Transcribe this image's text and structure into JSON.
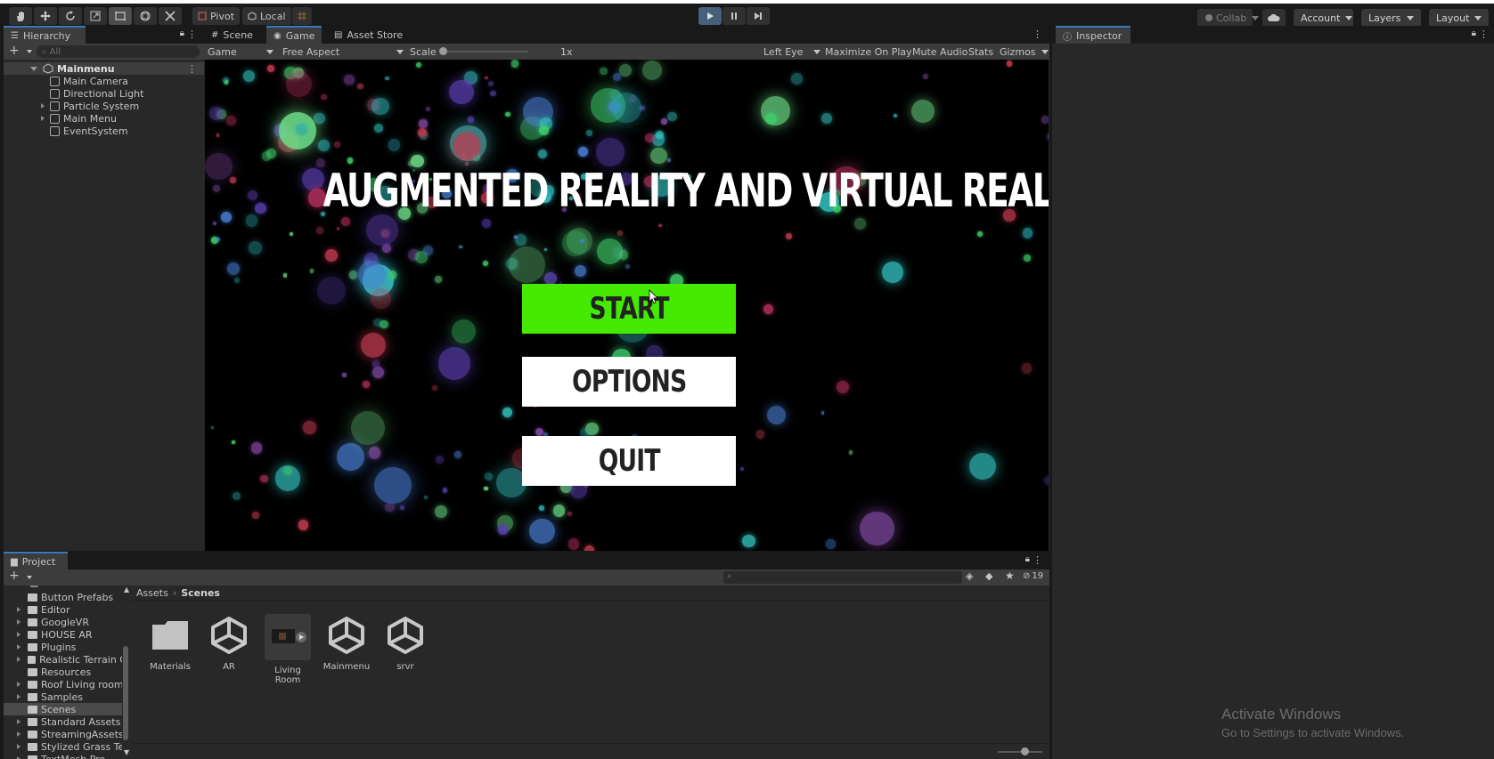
{
  "toolbar": {
    "tools": [
      "hand-tool",
      "move-tool",
      "rotate-tool",
      "scale-tool",
      "rect-tool",
      "transform-tool",
      "custom-tool"
    ],
    "pivot_label": "Pivot",
    "local_label": "Local",
    "collab_label": "Collab",
    "account_label": "Account",
    "layers_label": "Layers",
    "layout_label": "Layout"
  },
  "hierarchy": {
    "tab_label": "Hierarchy",
    "search_placeholder": "All",
    "scene_name": "Mainmenu",
    "items": [
      {
        "label": "Main Camera",
        "expandable": false
      },
      {
        "label": "Directional Light",
        "expandable": false
      },
      {
        "label": "Particle System",
        "expandable": true
      },
      {
        "label": "Main Menu",
        "expandable": true
      },
      {
        "label": "EventSystem",
        "expandable": false
      }
    ]
  },
  "center_tabs": {
    "scene": "Scene",
    "game": "Game",
    "asset_store": "Asset Store"
  },
  "gamebar": {
    "display": "Game",
    "aspect": "Free Aspect",
    "scale_label": "Scale",
    "scale_value": "1x",
    "eye": "Left Eye",
    "maximize": "Maximize On Play",
    "mute": "Mute Audio",
    "stats": "Stats",
    "gizmos": "Gizmos"
  },
  "game": {
    "title": "AUGMENTED REALITY AND VIRTUAL REALITY",
    "start": "START",
    "options": "OPTIONS",
    "quit": "QUIT",
    "start_color": "#45ea00"
  },
  "inspector": {
    "tab_label": "Inspector"
  },
  "project": {
    "tab_label": "Project",
    "hidden_count": "19",
    "breadcrumb_root": "Assets",
    "breadcrumb_current": "Scenes",
    "tree": [
      {
        "label": "Button Prefabs",
        "expandable": false
      },
      {
        "label": "Editor",
        "expandable": true
      },
      {
        "label": "GoogleVR",
        "expandable": true
      },
      {
        "label": "HOUSE AR",
        "expandable": true
      },
      {
        "label": "Plugins",
        "expandable": true
      },
      {
        "label": "Realistic Terrain C",
        "expandable": true
      },
      {
        "label": "Resources",
        "expandable": false
      },
      {
        "label": "Roof Living room",
        "expandable": true
      },
      {
        "label": "Samples",
        "expandable": true
      },
      {
        "label": "Scenes",
        "expandable": false,
        "selected": true
      },
      {
        "label": "Standard Assets",
        "expandable": true
      },
      {
        "label": "StreamingAssets",
        "expandable": true
      },
      {
        "label": "Stylized Grass Te",
        "expandable": true
      },
      {
        "label": "TextMesh Pro",
        "expandable": true
      }
    ],
    "assets": [
      {
        "label": "Materials",
        "icon": "folder-icon"
      },
      {
        "label": "AR",
        "icon": "unity-scene-icon"
      },
      {
        "label": "Living Room",
        "icon": "prefab-preview-icon"
      },
      {
        "label": "Mainmenu",
        "icon": "unity-scene-icon"
      },
      {
        "label": "srvr",
        "icon": "unity-scene-icon"
      }
    ]
  },
  "watermark": {
    "line1": "Activate Windows",
    "line2": "Go to Settings to activate Windows."
  }
}
